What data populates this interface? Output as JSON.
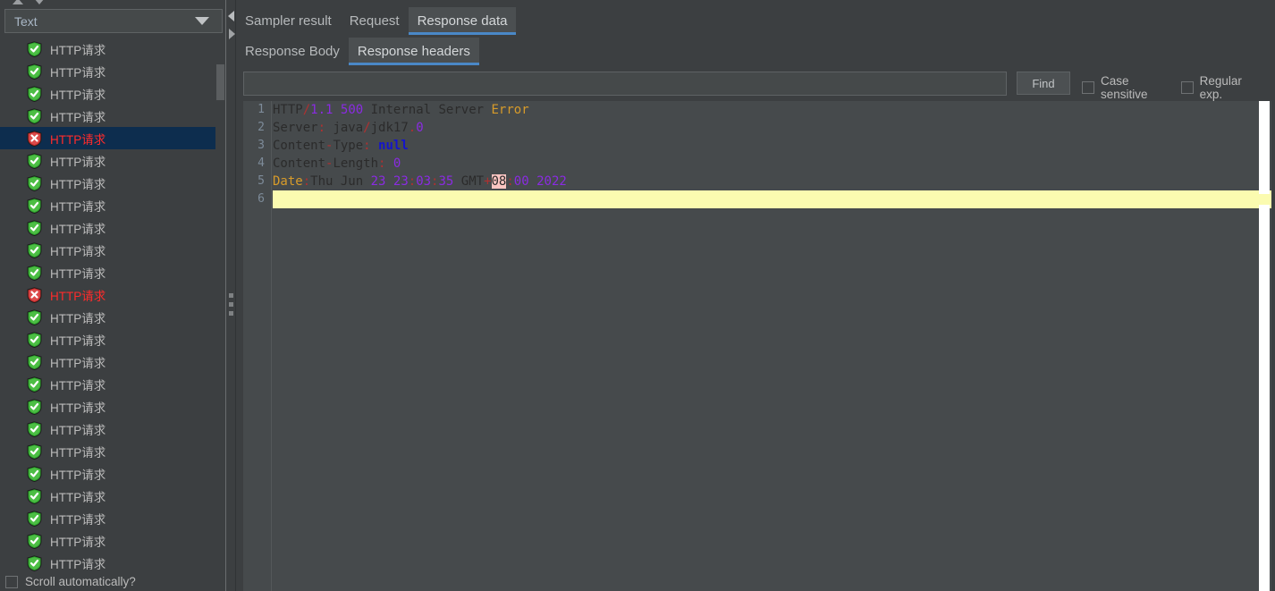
{
  "window": {
    "splitter_handle": "horizontal-splitter"
  },
  "left_panel": {
    "sort_up_icon": "sort-ascending-icon",
    "sort_down_icon": "sort-descending-icon",
    "view_combo": {
      "value": "Text",
      "chevron_icon": "chevron-down-icon"
    },
    "tree_items": [
      {
        "label": "HTTP请求",
        "status": "success"
      },
      {
        "label": "HTTP请求",
        "status": "success"
      },
      {
        "label": "HTTP请求",
        "status": "success"
      },
      {
        "label": "HTTP请求",
        "status": "success"
      },
      {
        "label": "HTTP请求",
        "status": "error",
        "selected": true
      },
      {
        "label": "HTTP请求",
        "status": "success"
      },
      {
        "label": "HTTP请求",
        "status": "success"
      },
      {
        "label": "HTTP请求",
        "status": "success"
      },
      {
        "label": "HTTP请求",
        "status": "success"
      },
      {
        "label": "HTTP请求",
        "status": "success"
      },
      {
        "label": "HTTP请求",
        "status": "success"
      },
      {
        "label": "HTTP请求",
        "status": "error"
      },
      {
        "label": "HTTP请求",
        "status": "success"
      },
      {
        "label": "HTTP请求",
        "status": "success"
      },
      {
        "label": "HTTP请求",
        "status": "success"
      },
      {
        "label": "HTTP请求",
        "status": "success"
      },
      {
        "label": "HTTP请求",
        "status": "success"
      },
      {
        "label": "HTTP请求",
        "status": "success"
      },
      {
        "label": "HTTP请求",
        "status": "success"
      },
      {
        "label": "HTTP请求",
        "status": "success"
      },
      {
        "label": "HTTP请求",
        "status": "success"
      },
      {
        "label": "HTTP请求",
        "status": "success"
      },
      {
        "label": "HTTP请求",
        "status": "success"
      },
      {
        "label": "HTTP请求",
        "status": "success"
      }
    ],
    "scroll_auto": {
      "label": "Scroll automatically?",
      "checked": false
    }
  },
  "splitter": {
    "collapse_left_icon": "triangle-left-icon",
    "collapse_right_icon": "triangle-right-icon"
  },
  "right_panel": {
    "tabs": [
      {
        "label": "Sampler result",
        "active": false
      },
      {
        "label": "Request",
        "active": false
      },
      {
        "label": "Response data",
        "active": true
      }
    ],
    "subtabs": [
      {
        "label": "Response Body",
        "active": false
      },
      {
        "label": "Response headers",
        "active": true
      }
    ],
    "find_bar": {
      "search_value": "",
      "search_placeholder": "",
      "find_label": "Find",
      "case_sensitive_label": "Case sensitive",
      "case_sensitive_checked": false,
      "regular_exp_label": "Regular exp.",
      "regular_exp_checked": false
    },
    "editor": {
      "line_numbers": [
        "1",
        "2",
        "3",
        "4",
        "5",
        "6"
      ],
      "caret_line": 6,
      "lines": [
        {
          "n": 1,
          "tokens": [
            {
              "t": "HTTP",
              "c": "plain"
            },
            {
              "t": "/",
              "c": "sep"
            },
            {
              "t": "1.1",
              "c": "num"
            },
            {
              "t": " ",
              "c": "plain"
            },
            {
              "t": "500",
              "c": "num"
            },
            {
              "t": " Internal Server ",
              "c": "plain"
            },
            {
              "t": "Error",
              "c": "err"
            }
          ]
        },
        {
          "n": 2,
          "tokens": [
            {
              "t": "Server",
              "c": "plain"
            },
            {
              "t": ":",
              "c": "sep"
            },
            {
              "t": " java",
              "c": "plain"
            },
            {
              "t": "/",
              "c": "sep"
            },
            {
              "t": "jdk17",
              "c": "plain"
            },
            {
              "t": ".",
              "c": "sep"
            },
            {
              "t": "0",
              "c": "num"
            }
          ]
        },
        {
          "n": 3,
          "tokens": [
            {
              "t": "Content",
              "c": "plain"
            },
            {
              "t": "-",
              "c": "sep"
            },
            {
              "t": "Type",
              "c": "plain"
            },
            {
              "t": ":",
              "c": "sep"
            },
            {
              "t": " ",
              "c": "plain"
            },
            {
              "t": "null",
              "c": "null"
            }
          ]
        },
        {
          "n": 4,
          "tokens": [
            {
              "t": "Content",
              "c": "plain"
            },
            {
              "t": "-",
              "c": "sep"
            },
            {
              "t": "Length",
              "c": "plain"
            },
            {
              "t": ":",
              "c": "sep"
            },
            {
              "t": " ",
              "c": "plain"
            },
            {
              "t": "0",
              "c": "num"
            }
          ]
        },
        {
          "n": 5,
          "tokens": [
            {
              "t": "Date",
              "c": "key"
            },
            {
              "t": ":",
              "c": "sep"
            },
            {
              "t": "Thu Jun ",
              "c": "plain"
            },
            {
              "t": "23",
              "c": "num"
            },
            {
              "t": " ",
              "c": "plain"
            },
            {
              "t": "23",
              "c": "num"
            },
            {
              "t": ":",
              "c": "sep"
            },
            {
              "t": "03",
              "c": "num"
            },
            {
              "t": ":",
              "c": "sep"
            },
            {
              "t": "35",
              "c": "num"
            },
            {
              "t": " GMT",
              "c": "plain"
            },
            {
              "t": "+",
              "c": "sep"
            },
            {
              "t": "08",
              "c": "hl"
            },
            {
              "t": ":",
              "c": "sep"
            },
            {
              "t": "00",
              "c": "num"
            },
            {
              "t": " ",
              "c": "plain"
            },
            {
              "t": "2022",
              "c": "num"
            }
          ]
        },
        {
          "n": 6,
          "tokens": []
        }
      ]
    }
  }
}
